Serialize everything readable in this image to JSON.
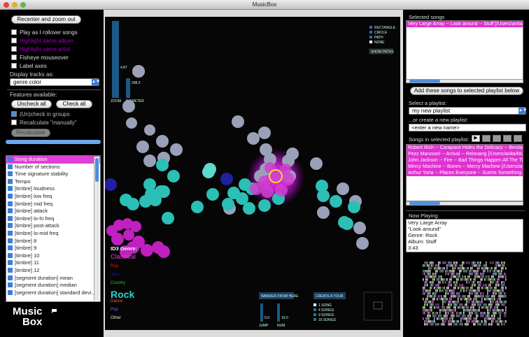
{
  "window": {
    "title": "MusicBox"
  },
  "left_panel": {
    "recenter_label": "Recenter and zoom out",
    "options": [
      {
        "label": "Play as I rollover songs",
        "checked": false,
        "color": "#dddddd"
      },
      {
        "label": "Highlight same album",
        "checked": false,
        "color": "#a000c0"
      },
      {
        "label": "Highlight same artist",
        "checked": false,
        "color": "#a000c0"
      },
      {
        "label": "Fisheye mouseover",
        "checked": false,
        "color": "#dddddd"
      },
      {
        "label": "Label axes",
        "checked": false,
        "color": "#dddddd"
      }
    ],
    "display_tracks_label": "Display tracks as:",
    "display_tracks_value": "genre color",
    "features_label": "Features available:",
    "uncheck_all": "Uncheck all",
    "check_all": "Check all",
    "uncheck_in_groups": "(Un)check in groups",
    "recalculate": "Recalculate \"manually\"",
    "recalculate_btn": "Recalculate",
    "features": [
      "Song duration",
      "Number of sections",
      "Time signature stability",
      "Tempo",
      "[timbre] loudness",
      "[timbre] low freq",
      "[timbre] mid freq",
      "[timbre] attack",
      "[timbre] lo-hi freq",
      "[timbre] post-attack",
      "[timbre] lo-mid freq",
      "[timbre] 8",
      "[timbre] 9",
      "[timbre] 10",
      "[timbre] 11",
      "[timbre] 12",
      "[segment duration] mean",
      "[segment duration] median",
      "[segment duration] standard devi..."
    ],
    "logo_line1": "Music",
    "logo_line2": "Box"
  },
  "center": {
    "sliders": {
      "zoom_label": "ZOOM",
      "zoom_value": "4.87",
      "diameter_label": "DIAMETER",
      "diameter_value": "298.2"
    },
    "shape_legend": [
      {
        "label": "RECTANGLE",
        "color": "#2b6fa0"
      },
      {
        "label": "CIRCLE",
        "color": "#2b6fa0"
      },
      {
        "label": "PATH",
        "color": "#2b6fa0"
      },
      {
        "label": "NONE",
        "color": "#ffffff"
      }
    ],
    "show_paths": "SHOW PATHS",
    "genre_title": "ID3 Genre:",
    "genres": [
      {
        "name": "Classical",
        "color": "#e040e0"
      },
      {
        "name": "Rap",
        "color": "#e01010"
      },
      {
        "name": "Jazz",
        "color": "#1a1ab0"
      },
      {
        "name": "Country",
        "color": "#30c020"
      },
      {
        "name": "Rock",
        "color": "#30d0d0"
      },
      {
        "name": "Dance",
        "color": "#ff6010"
      },
      {
        "name": "Pop",
        "color": "#6060ff"
      },
      {
        "name": "Other",
        "color": "#e0e0e0"
      }
    ],
    "wander_label": "WANDER FROM HERE",
    "jump_label": "JUMP",
    "jump_value": "5.0",
    "num_label": "NUM",
    "num_value": "10.0",
    "tour_label": "CREATE A TOUR",
    "tour_options": [
      "1 SONG",
      "4 SONGS",
      "9 SONGS",
      "16 SONGS"
    ]
  },
  "right_panel": {
    "selected_songs_label": "Selected songs",
    "selected_songs": [
      "Very Large Array -- Look around -- Stuff [/Users/anita/"
    ],
    "add_songs_btn": "Add these songs to selected playlist below",
    "select_playlist_label": "Select a playlist:",
    "playlist_value": "my new playlist",
    "create_playlist_label": "...or create a new playlist:",
    "new_playlist_placeholder": "<enter a new name>",
    "songs_in_playlist_label": "Songs in selected playlist:",
    "playlist_songs": [
      "Robert Rich -- Carapace Hides the Delicacy -- Bestiary",
      "Pezz Manzoori -- Arrival -- Reisnang [/Users/anita/Mu",
      "John Jackson -- Fire -- Bad Things Happen All The Tim",
      "Mercy Machine -- Bones -- Mercy Machine [/Users/anit",
      "Arthur Yoria -- Places Everyone -- Suerte Something [/"
    ],
    "now_playing_label": "Now Playing",
    "now_playing": [
      "Very Large Array",
      "\"Look around\"",
      "Genre: Rock",
      "Album: Stuff",
      "3:43"
    ]
  }
}
